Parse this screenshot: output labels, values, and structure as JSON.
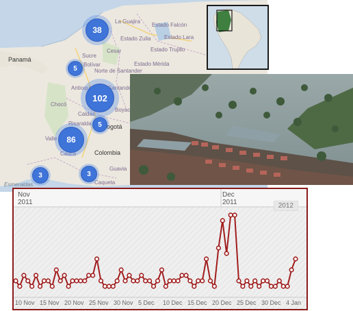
{
  "map": {
    "places": {
      "panama": "Panamá",
      "la_guajira": "La Guajira",
      "estado_falcon": "Estado Falcón",
      "estado_zulia": "Estado Zulia",
      "estado_lara": "Estado Lara",
      "estado_trujillo": "Estado Trujillo",
      "estado_merida": "Estado Mérida",
      "sucre": "Sucre",
      "cesar": "Cesar",
      "bolivar": "Bolívar",
      "norte_santander": "Norte de Santander",
      "antioquia": "Antioquia",
      "santander": "Santander",
      "choco": "Chocó",
      "boyaca": "Boyacá",
      "caldas": "Caldas",
      "risaralda": "Risaralda",
      "bogota": "Bogotá",
      "valle": "Valle",
      "cauca": "Cauca",
      "colombia": "Colombia",
      "guavia": "Guavia",
      "esmeraldas": "Esmeraldas",
      "caqueta": "Caqueta"
    },
    "clusters": [
      {
        "label": "38"
      },
      {
        "label": "5"
      },
      {
        "label": "102"
      },
      {
        "label": "5"
      },
      {
        "label": "86"
      },
      {
        "label": "3"
      },
      {
        "label": "3"
      }
    ],
    "land_color": "#ece8df",
    "water_color": "#c4d6e8",
    "cluster_color": "#3f74d8"
  },
  "inset": {
    "icon": "south-america-locator-map"
  },
  "photo": {
    "subject": "flooded-town-aerial-photo"
  },
  "timeline": {
    "months": [
      {
        "name": "Nov",
        "year": "2011"
      },
      {
        "name": "Dec",
        "year": "2011"
      }
    ],
    "year_badge": "2012",
    "ticks": [
      "10 Nov",
      "15 Nov",
      "20 Nov",
      "25 Nov",
      "30 Nov",
      "5 Dec",
      "10 Dec",
      "15 Dec",
      "20 Dec",
      "25 Dec",
      "30 Dec",
      "4 Jan"
    ],
    "line_color": "#a01c1c"
  },
  "chart_data": {
    "type": "line",
    "title": "",
    "xlabel": "",
    "ylabel": "",
    "x_start": "2011-11-08",
    "x_step_days": 1,
    "values": [
      2,
      1,
      3,
      2,
      1,
      3,
      1,
      2,
      2,
      1,
      4,
      2,
      3,
      1,
      2,
      2,
      2,
      2,
      3,
      3,
      6,
      2,
      1,
      1,
      1,
      2,
      4,
      2,
      3,
      2,
      2,
      3,
      2,
      2,
      1,
      2,
      4,
      1,
      2,
      2,
      2,
      3,
      3,
      2,
      1,
      2,
      2,
      6,
      2,
      1,
      8,
      13,
      7,
      14,
      14,
      2,
      1,
      2,
      1,
      2,
      1,
      2,
      2,
      1,
      1,
      2,
      1,
      1,
      4,
      6
    ],
    "ylim": [
      0,
      15
    ],
    "grid": false
  }
}
